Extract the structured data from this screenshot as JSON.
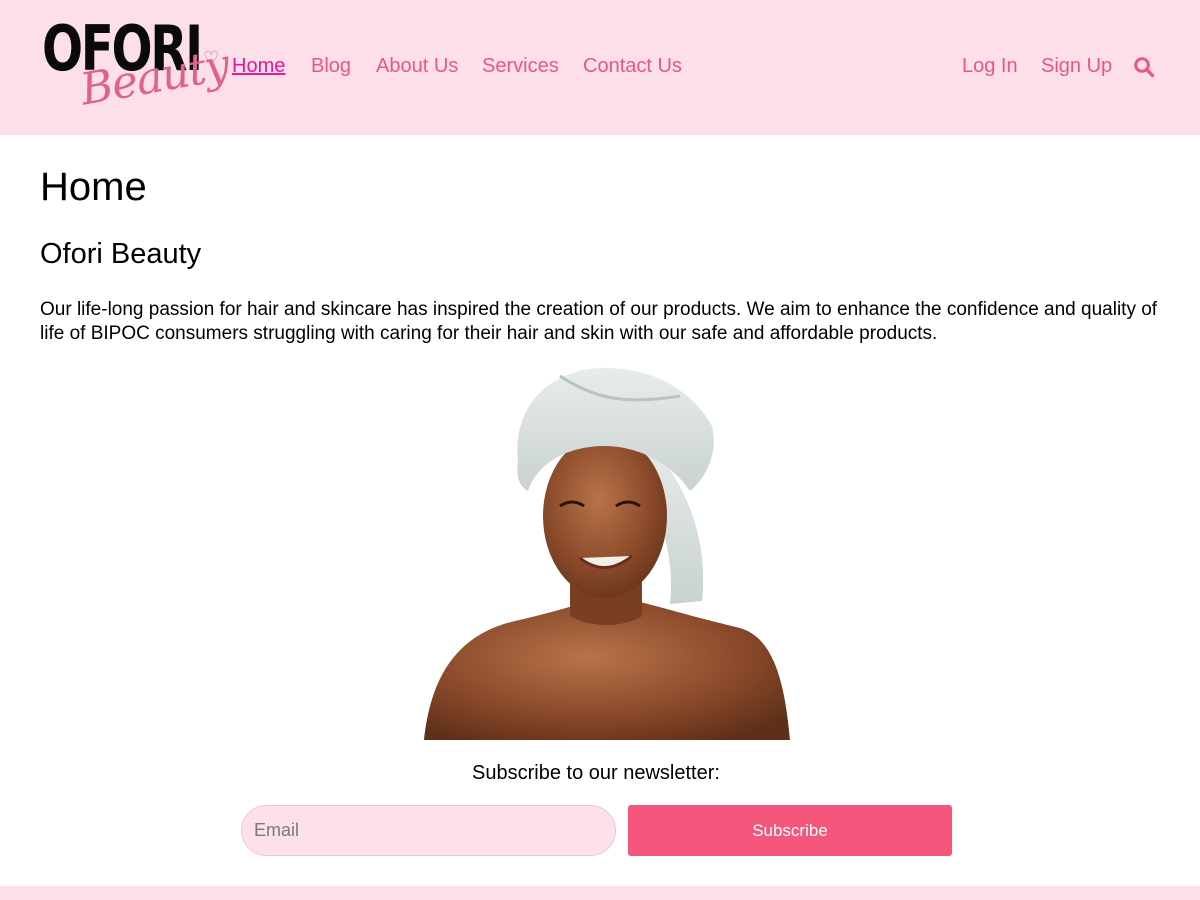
{
  "header": {
    "logo": {
      "main": "OFORI",
      "script": "Beauty"
    },
    "nav": [
      "Home",
      "Blog",
      "About Us",
      "Services",
      "Contact Us"
    ],
    "active_nav": "Home",
    "auth": {
      "login": "Log In",
      "signup": "Sign Up"
    },
    "search_icon": "search-icon"
  },
  "main": {
    "page_title": "Home",
    "section_title": "Ofori Beauty",
    "intro": "Our life-long passion for hair and skincare has inspired the creation of our products. We aim to enhance the confidence and quality of life of BIPOC consumers struggling with caring for their hair and skin with our safe and affordable products.",
    "hero_image": "woman-with-towel-on-head-photo"
  },
  "newsletter": {
    "label": "Subscribe to our newsletter:",
    "email_placeholder": "Email",
    "email_value": "",
    "button_label": "Subscribe"
  },
  "colors": {
    "header_bg": "#fddfe9",
    "link": "#ea5782",
    "active_link": "#e4189a",
    "button": "#f4567c",
    "input_bg": "#fde0ea"
  }
}
